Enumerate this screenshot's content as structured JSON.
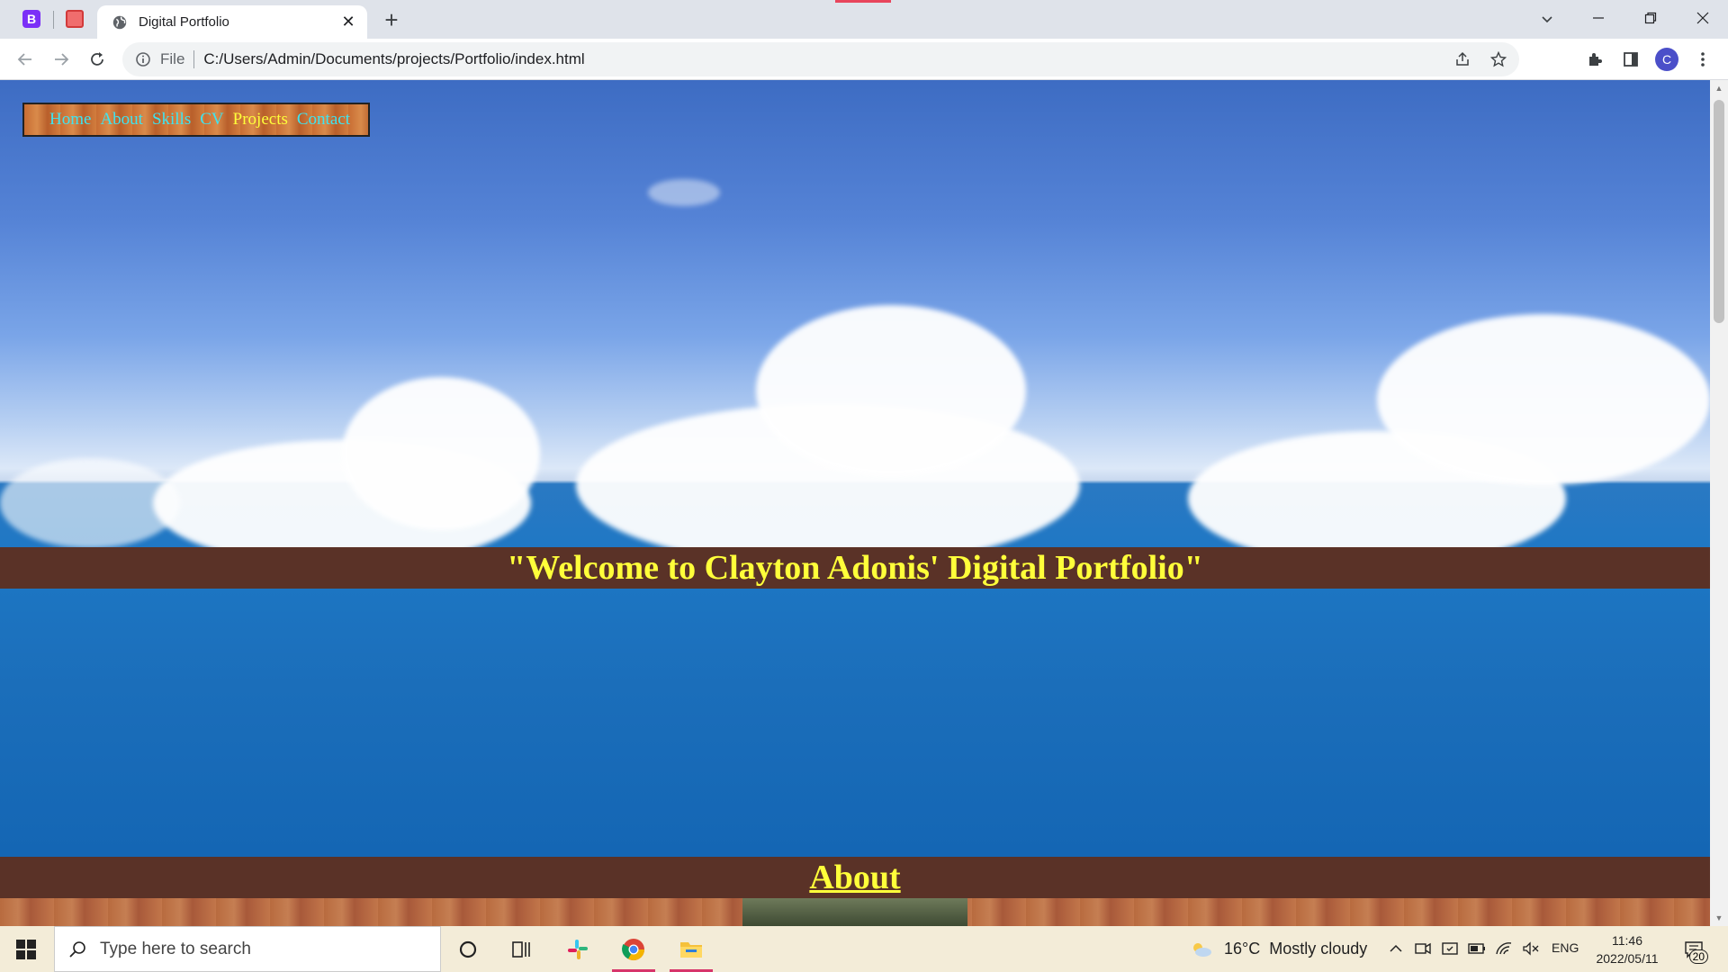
{
  "browser": {
    "pinned_tabs": [
      {
        "icon": "b-favicon",
        "letter": "B"
      },
      {
        "icon": "s-favicon"
      }
    ],
    "active_tab": {
      "title": "Digital Portfolio",
      "icon": "globe-icon"
    },
    "new_tab_label": "+",
    "omnibox": {
      "scheme": "File",
      "url": "C:/Users/Admin/Documents/projects/Portfolio/index.html"
    },
    "avatar_letter": "C"
  },
  "page": {
    "nav_links": [
      {
        "label": "Home",
        "active": false
      },
      {
        "label": "About",
        "active": false
      },
      {
        "label": "Skills",
        "active": false
      },
      {
        "label": "CV",
        "active": false
      },
      {
        "label": "Projects",
        "active": true
      },
      {
        "label": "Contact",
        "active": false
      }
    ],
    "welcome_heading": "\"Welcome to Clayton Adonis' Digital Portfolio\"",
    "about_heading": "About",
    "colors": {
      "bar_bg": "#5a3227",
      "heading": "#ffff3a",
      "link": "#3ee4f0"
    }
  },
  "taskbar": {
    "search_placeholder": "Type here to search",
    "weather": {
      "temp": "16°C",
      "condition": "Mostly cloudy"
    },
    "language": "ENG",
    "time": "11:46",
    "date": "2022/05/11",
    "notification_count": "20"
  }
}
